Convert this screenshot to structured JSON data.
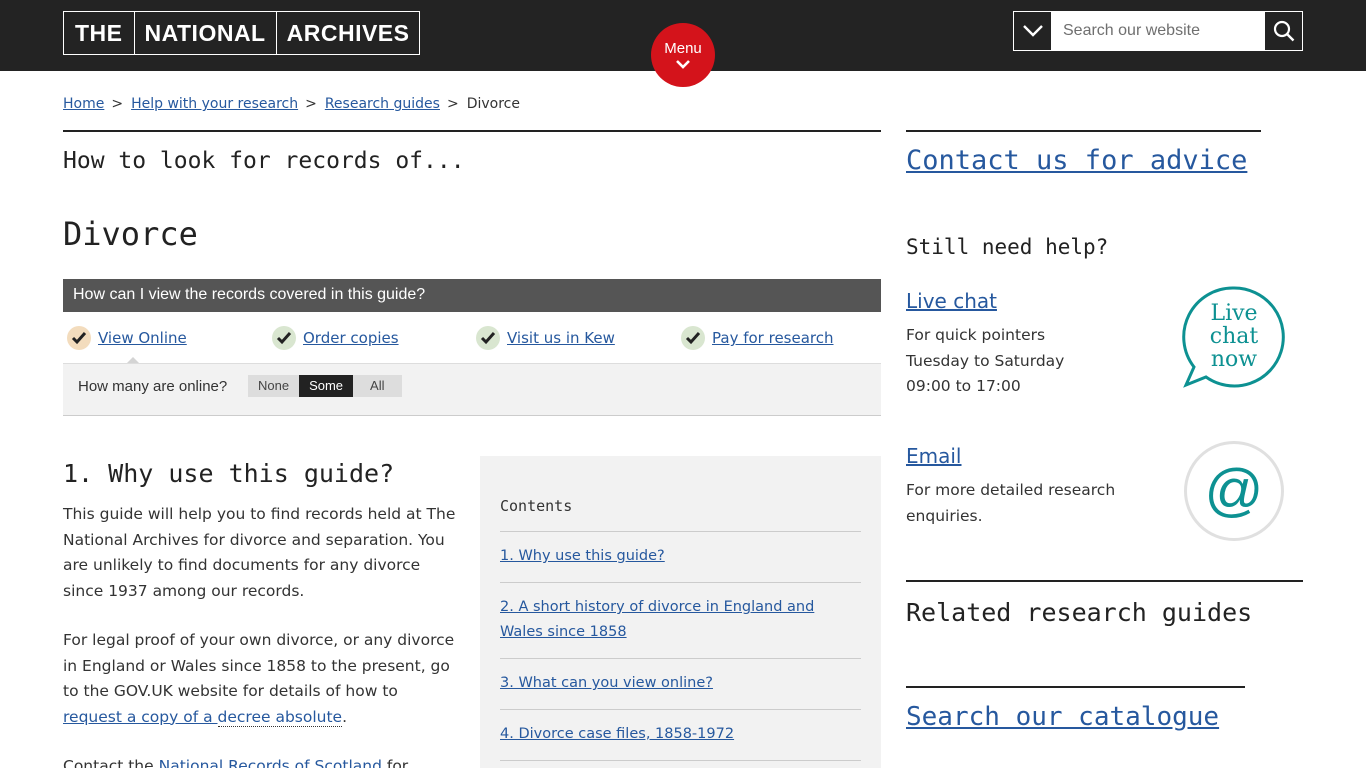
{
  "header": {
    "logo_words": [
      "THE",
      "NATIONAL",
      "ARCHIVES"
    ],
    "menu_label": "Menu",
    "search_placeholder": "Search our website"
  },
  "breadcrumb": {
    "items": [
      "Home",
      "Help with your research",
      "Research guides"
    ],
    "current": "Divorce",
    "separator": ">"
  },
  "main": {
    "pre_title": "How to look for records of...",
    "title": "Divorce",
    "view_panel": {
      "heading": "How can I view the records covered in this guide?",
      "options": [
        "View Online",
        "Order copies",
        "Visit us in Kew",
        "Pay for research"
      ],
      "active_option": "View Online",
      "online_question": "How many are online?",
      "online_levels": [
        "None",
        "Some",
        "All"
      ],
      "online_selected": "Some"
    },
    "section1": {
      "title": "1. Why use this guide?",
      "p1": "This guide will help you to find records held at The National Archives for divorce and separation. You are unlikely to find documents for any divorce since 1937 among our records.",
      "p2_before": "For legal proof of your own divorce, or any divorce in England or Wales since 1858 to the present, go to the GOV.UK website for details of how to ",
      "p2_link": "request a copy of a ",
      "p2_link2": "decree absolute",
      "p2_after": ".",
      "p3_before": "Contact the ",
      "p3_link": "National Records of Scotland",
      "p3_after": " for"
    },
    "contents": {
      "title": "Contents",
      "items": [
        "1. Why use this guide?",
        "2. A short history of divorce in England and Wales since 1858",
        "3. What can you view online?",
        "4. Divorce case files, 1858-1972"
      ]
    }
  },
  "sidebar": {
    "contact_link": "Contact us for advice",
    "still_need_help": "Still need help?",
    "live_chat": {
      "link": "Live chat",
      "lines": [
        "For quick pointers",
        "Tuesday to Saturday",
        "09:00 to 17:00"
      ],
      "badge_lines": [
        "Live",
        "chat",
        "now"
      ]
    },
    "email": {
      "link": "Email",
      "text": "For more detailed research enquiries.",
      "symbol": "@"
    },
    "related_title": "Related research guides",
    "catalogue_link": "Search our catalogue"
  },
  "colors": {
    "header_bg": "#232323",
    "menu_red": "#d4131b",
    "link_blue": "#26589e",
    "teal": "#0d9192",
    "panel_head": "#555555"
  }
}
